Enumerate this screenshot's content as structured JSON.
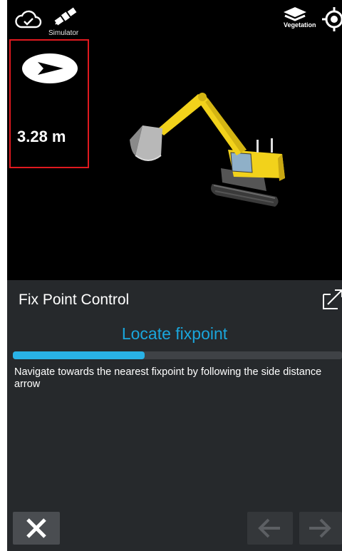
{
  "status_bar": {
    "cloud_icon": "cloud-check-icon",
    "satellite_icon": "satellite-icon",
    "satellite_label": "Simulator",
    "layers_icon": "layers-icon",
    "layers_label": "Vegetation",
    "locate_icon": "crosshair-icon"
  },
  "distance_widget": {
    "arrow_icon": "direction-arrow-icon",
    "value": "3.28 m",
    "border_color": "#e0191f"
  },
  "viewport": {
    "model": "excavator-model",
    "machine_color": "#f2d21b"
  },
  "panel": {
    "title": "Fix Point Control",
    "popout_icon": "popout-icon",
    "step_title": "Locate fixpoint",
    "progress_fraction": 0.4,
    "instruction": "Navigate towards the nearest fixpoint by following the side distance arrow",
    "accent_color": "#1aa6dc"
  },
  "footer": {
    "close_icon": "close-icon",
    "prev_icon": "arrow-left-icon",
    "next_icon": "arrow-right-icon",
    "prev_enabled": false,
    "next_enabled": false
  }
}
